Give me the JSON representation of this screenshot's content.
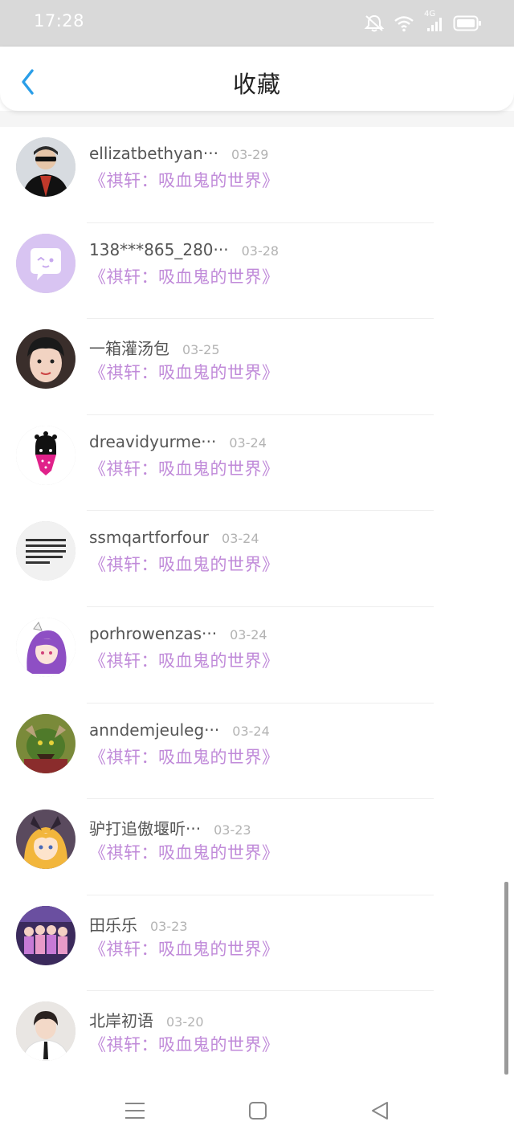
{
  "status_bar": {
    "time": "17:28",
    "network_label": "4G",
    "icons": [
      "mute-bell-icon",
      "wifi-icon",
      "signal-icon",
      "battery-icon"
    ]
  },
  "header": {
    "title": "收藏",
    "back_icon": "chevron-left-icon",
    "accent_color": "#2a9ee8"
  },
  "favorites": [
    {
      "user": "ellizatbethyan···",
      "date": "03-29",
      "book": "《祺轩：吸血鬼的世界》"
    },
    {
      "user": "138***865_280···",
      "date": "03-28",
      "book": "《祺轩：吸血鬼的世界》"
    },
    {
      "user": "一箱灌汤包",
      "date": "03-25",
      "book": "《祺轩：吸血鬼的世界》"
    },
    {
      "user": "dreavidyurme···",
      "date": "03-24",
      "book": "《祺轩：吸血鬼的世界》"
    },
    {
      "user": "ssmqartforfour",
      "date": "03-24",
      "book": "《祺轩：吸血鬼的世界》"
    },
    {
      "user": "porhrowenzas···",
      "date": "03-24",
      "book": "《祺轩：吸血鬼的世界》"
    },
    {
      "user": "anndemjeuleg···",
      "date": "03-24",
      "book": "《祺轩：吸血鬼的世界》"
    },
    {
      "user": "驴打追傲堰听···",
      "date": "03-23",
      "book": "《祺轩：吸血鬼的世界》"
    },
    {
      "user": "田乐乐",
      "date": "03-23",
      "book": "《祺轩：吸血鬼的世界》"
    },
    {
      "user": "北岸初语",
      "date": "03-20",
      "book": "《祺轩：吸血鬼的世界》"
    }
  ],
  "book_title_color": "#c08ad9",
  "nav_bar": {
    "icons": [
      "menu-icon",
      "home-square-icon",
      "back-triangle-icon"
    ]
  }
}
